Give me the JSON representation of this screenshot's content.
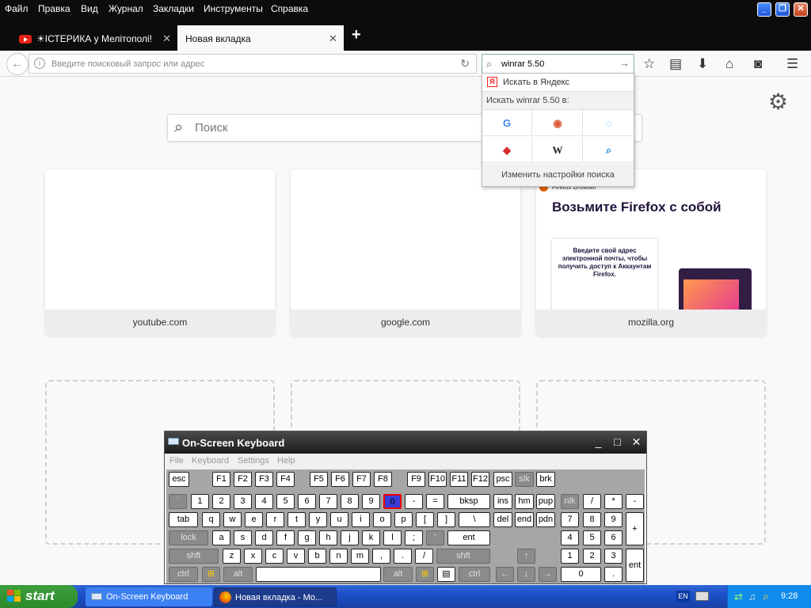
{
  "menubar": {
    "items": [
      "Файл",
      "Правка",
      "Вид",
      "Журнал",
      "Закладки",
      "Инструменты",
      "Справка"
    ],
    "window_buttons": [
      "_",
      "❐",
      "✕"
    ]
  },
  "tabs": [
    {
      "label": "☀ІСТЕРИКА у Мелітополі! К...",
      "close": "✕"
    },
    {
      "label": "Новая вкладка",
      "close": "✕"
    }
  ],
  "newtab_button": "+",
  "navbar": {
    "back": "←",
    "url_placeholder": "Введите поисковый запрос или адрес",
    "reload": "↻",
    "search_value": "winrar 5.50",
    "search_go": "→",
    "toolbar_icons": {
      "bookmark": "☆",
      "library": "▤",
      "downloads": "⬇",
      "home": "⌂",
      "pocket": "◙",
      "menu": "☰"
    }
  },
  "search_popup": {
    "yandex_label": "Искать в Яндекс",
    "header": "Искать winrar 5.50 в:",
    "engines": [
      {
        "name": "google",
        "glyph": "G",
        "color": "#4285f4"
      },
      {
        "name": "duckduckgo",
        "glyph": "◉",
        "color": "#de5833"
      },
      {
        "name": "other-engine",
        "glyph": "◌",
        "color": "#4ab0e4"
      },
      {
        "name": "red-engine",
        "glyph": "◆",
        "color": "#d92b2b"
      },
      {
        "name": "wikipedia",
        "glyph": "W",
        "color": "#000000"
      },
      {
        "name": "blue-search",
        "glyph": "⌕",
        "color": "#1e88d6"
      }
    ],
    "settings_label": "Изменить настройки поиска"
  },
  "page": {
    "search_placeholder": "Поиск",
    "tiles": [
      {
        "caption": "youtube.com"
      },
      {
        "caption": "google.com"
      },
      {
        "caption": "mozilla.org"
      }
    ],
    "mozilla_thumb": {
      "brand": "Firefox Browser",
      "heading": "Возьмите Firefox с собой",
      "card_text": "Введите свой адрес электронной почты, чтобы получить доступ к Аккаунтам Firefox."
    }
  },
  "osk": {
    "title": "On-Screen Keyboard",
    "menu": [
      "File",
      "Keyboard",
      "Settings",
      "Help"
    ],
    "title_buttons": [
      "_",
      "□",
      "✕"
    ],
    "keys": {
      "row1": [
        "esc",
        "F1",
        "F2",
        "F3",
        "F4",
        "F5",
        "F6",
        "F7",
        "F8",
        "F9",
        "F10",
        "F11",
        "F12",
        "psc",
        "slk",
        "brk"
      ],
      "row2": [
        "`",
        "1",
        "2",
        "3",
        "4",
        "5",
        "6",
        "7",
        "8",
        "9",
        "0",
        "-",
        "=",
        "bksp",
        "ins",
        "hm",
        "pup",
        "nlk",
        "/",
        "*",
        "-"
      ],
      "row3": [
        "tab",
        "q",
        "w",
        "e",
        "r",
        "t",
        "y",
        "u",
        "i",
        "o",
        "p",
        "[",
        "]",
        "\\",
        "del",
        "end",
        "pdn",
        "7",
        "8",
        "9",
        "+"
      ],
      "row4": [
        "lock",
        "a",
        "s",
        "d",
        "f",
        "g",
        "h",
        "j",
        "k",
        "l",
        ";",
        "'",
        "ent",
        "4",
        "5",
        "6"
      ],
      "row5": [
        "shft",
        "z",
        "x",
        "c",
        "v",
        "b",
        "n",
        "m",
        ",",
        ".",
        "/",
        "shft",
        "↑",
        "1",
        "2",
        "3",
        "ent"
      ],
      "row6": [
        "ctrl",
        "⊞",
        "alt",
        "",
        "alt",
        "⊞",
        "▤",
        "ctrl",
        "←",
        "↓",
        "→",
        "0",
        "."
      ]
    }
  },
  "taskbar": {
    "start": "start",
    "tasks": [
      "On-Screen Keyboard",
      "Новая вкладка - Mo..."
    ],
    "lang": "EN",
    "clock": "9:28"
  }
}
